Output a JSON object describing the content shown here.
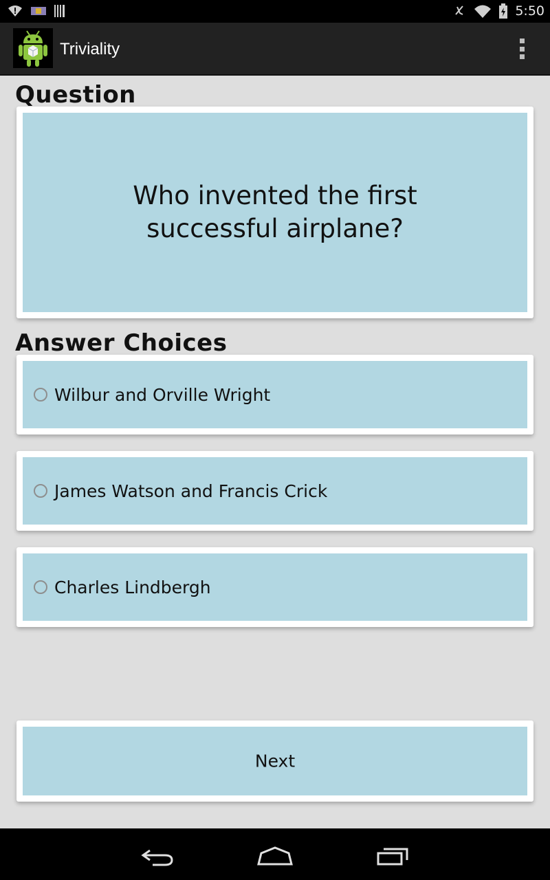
{
  "status_bar": {
    "time": "5:50",
    "left_icons": [
      "wifi-alert-icon",
      "notification-badge-icon",
      "barcode-icon"
    ],
    "right_icons": [
      "muted-icon",
      "wifi-icon",
      "battery-icon"
    ]
  },
  "action_bar": {
    "title": "Triviality",
    "app_icon": "android-app-icon",
    "menu_icon": "overflow-menu-icon"
  },
  "question": {
    "section_label": "Question",
    "text": "Who invented the first successful airplane?"
  },
  "answers": {
    "section_label": "Answer Choices",
    "choices": [
      {
        "label": "Wilbur and Orville Wright",
        "selected": false
      },
      {
        "label": "James Watson and Francis Crick",
        "selected": false
      },
      {
        "label": "Charles Lindbergh",
        "selected": false
      }
    ]
  },
  "footer": {
    "next_label": "Next"
  },
  "nav_bar": {
    "icons": [
      "back-icon",
      "home-icon",
      "recents-icon"
    ]
  },
  "colors": {
    "card_fill": "#b2d7e2",
    "background": "#dedede",
    "action_bar": "#222222"
  }
}
